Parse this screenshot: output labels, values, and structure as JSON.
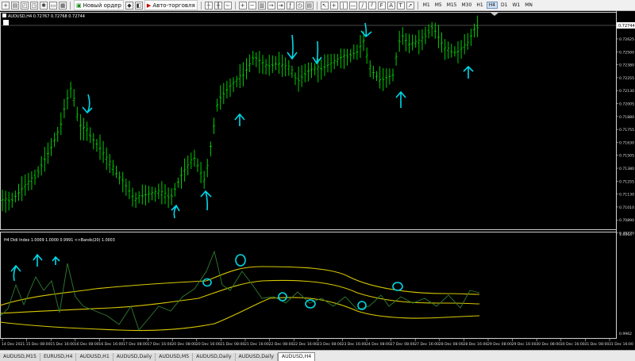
{
  "toolbar": {
    "new_order_label": "Новый ордер",
    "auto_trading_label": "Авто-торговля",
    "timeframes": [
      "M1",
      "M5",
      "M15",
      "M30",
      "H1",
      "H4",
      "D1",
      "W1",
      "MN"
    ]
  },
  "main_chart": {
    "title": "AUDUSD,H4  0.72767 0.72768 0.72744",
    "current_price_label": "0.72744",
    "price_ticks": [
      "0.72625",
      "0.72500",
      "0.72380",
      "0.72255",
      "0.72130",
      "0.72005",
      "0.71880",
      "0.71755",
      "0.71630",
      "0.71505",
      "0.71380",
      "0.71255",
      "0.71130",
      "0.71010",
      "0.70890",
      "0.70770"
    ]
  },
  "indicator": {
    "title": "H4 Didi Index 1.0009 1.0000 0.9991  <<Bands(20) 1.0003",
    "ticks": [
      "1.0064",
      "0.9962"
    ]
  },
  "time_axis": [
    "14 Dec 2021",
    "15 Dec 08:00",
    "15 Dec 16:00",
    "16 Dec 08:00",
    "16 Dec 16:00",
    "17 Dec 08:00",
    "17 Dec 16:00",
    "20 Dec 08:00",
    "20 Dec 16:00",
    "21 Dec 08:00",
    "21 Dec 16:00",
    "22 Dec 08:00",
    "22 Dec 16:00",
    "23 Dec 08:00",
    "23 Dec 16:00",
    "24 Dec 08:00",
    "27 Dec 08:00",
    "27 Dec 16:00",
    "28 Dec 08:00",
    "28 Dec 16:00",
    "29 Dec 08:00",
    "29 Dec 16:00",
    "30 Dec 08:00",
    "30 Dec 16:00",
    "31 Dec 08:00",
    "31 Dec 16:00"
  ],
  "tabs": [
    "AUDUSD,M15",
    "EURUSD,H4",
    "AUDUSD,H1",
    "AUDUSD,Daily",
    "AUDUSD,M5",
    "AUDUSD,Daily",
    "AUDUSD,Daily",
    "AUDUSD,H4"
  ],
  "active_tab": 7,
  "colors": {
    "candles": "#00cc00",
    "bands": "#d8c800",
    "annotations": "#00d7e6",
    "didi": "#2f7d2f"
  }
}
